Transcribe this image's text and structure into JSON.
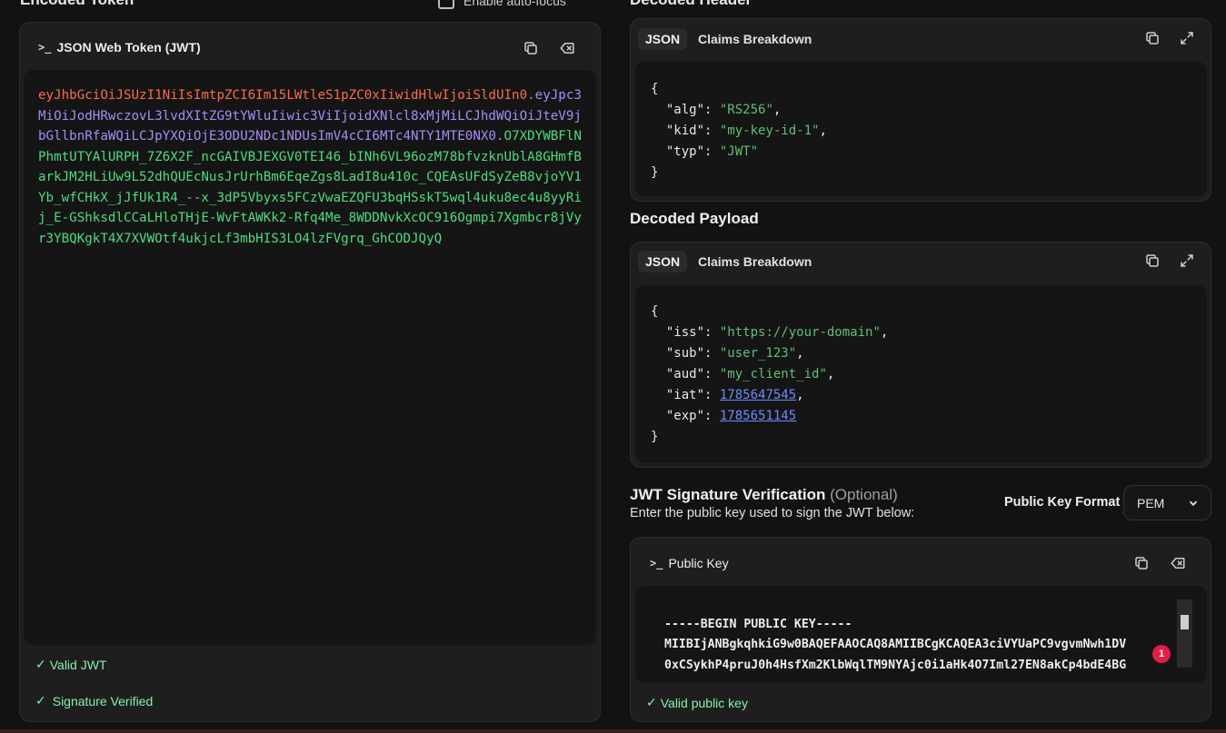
{
  "encoded": {
    "title": "Encoded Token",
    "auto_focus_label": "Enable auto-focus",
    "card_title": "JSON Web Token (JWT)",
    "token_header": "eyJhbGciOiJSUzI1NiIsImtpZCI6Im15LWtleS1pZC0xIiwidHlwIjoiSldUIn0",
    "token_payload": "eyJpc3MiOiJodHRwczovL3lvdXItZG9tYWluIiwic3ViIjoidXNlcl8xMjMiLCJhdWQiOiJteV9jbGllbnRfaWQiLCJpYXQiOjE3ODU2NDc1NDUsImV4cCI6MTc4NTY1MTE0NX0",
    "token_signature": "O7XDYWBFlNPhmtUTYAlURPH_7Z6X2F_ncGAIVBJEXGV0TEI46_bINh6VL96ozM78bfvzknUblA8GHmfBarkJM2HLiUw9L52dhQUEcNusJrUrhBm6EqeZgs8LadI8u410c_CQEAsUFdSyZeB8vjoYV1Yb_wfCHkX_jJfUk1R4_--x_3dP5Vbyxs5FCzVwaEZQFU3bqHSskT5wql4uku8ec4u8yyRij_E-GShksdlCCaLHloTHjE-WvFtAWKk2-Rfq4Me_8WDDNvkXcOC916Ogmpi7Xgmbcr8jVyr3YBQKgkT4X7XVWOtf4ukjcLf3mbHIS3LO4lzFVgrq_GhCODJQyQ",
    "status_valid": "Valid JWT",
    "status_signature": "Signature Verified"
  },
  "decoded_header": {
    "title": "Decoded Header",
    "tab_json": "JSON",
    "tab_claims": "Claims Breakdown",
    "lines": {
      "open": "{",
      "alg_key": "\"alg\"",
      "alg_val": "\"RS256\"",
      "kid_key": "\"kid\"",
      "kid_val": "\"my-key-id-1\"",
      "typ_key": "\"typ\"",
      "typ_val": "\"JWT\"",
      "close": "}"
    }
  },
  "decoded_payload": {
    "title": "Decoded Payload",
    "tab_json": "JSON",
    "tab_claims": "Claims Breakdown",
    "lines": {
      "open": "{",
      "iss_key": "\"iss\"",
      "iss_val": "\"https://your-domain\"",
      "sub_key": "\"sub\"",
      "sub_val": "\"user_123\"",
      "aud_key": "\"aud\"",
      "aud_val": "\"my_client_id\"",
      "iat_key": "\"iat\"",
      "iat_val": "1785647545",
      "exp_key": "\"exp\"",
      "exp_val": "1785651145",
      "close": "}"
    }
  },
  "verification": {
    "title": "JWT Signature Verification",
    "optional": "(Optional)",
    "subtitle": "Enter the public key used to sign the JWT below:",
    "format_label": "Public Key Format",
    "format_value": "PEM",
    "card_title": "Public Key",
    "pem_line1": "-----BEGIN PUBLIC KEY-----",
    "pem_line2": "MIIBIjANBgkqhkiG9w0BAQEFAAOCAQ8AMIIBCgKCAQEA3ciVYUaPC9vgvmNwh1DV",
    "pem_line3": "0xCSykhP4pruJ0h4HsfXm2KlbWqlTM9NYAjc0i1aHk4O7Iml27EN8akCp4bdE4BG",
    "badge_count": "1",
    "status_valid": "Valid public key"
  },
  "colors": {
    "header_segment": "#fb6a4a",
    "payload_segment": "#a78bfa",
    "signature_segment": "#4ade80",
    "string_value": "#5fbf74",
    "number_value": "#6b8cff",
    "valid_status": "#86efac",
    "badge": "#e11d48"
  }
}
